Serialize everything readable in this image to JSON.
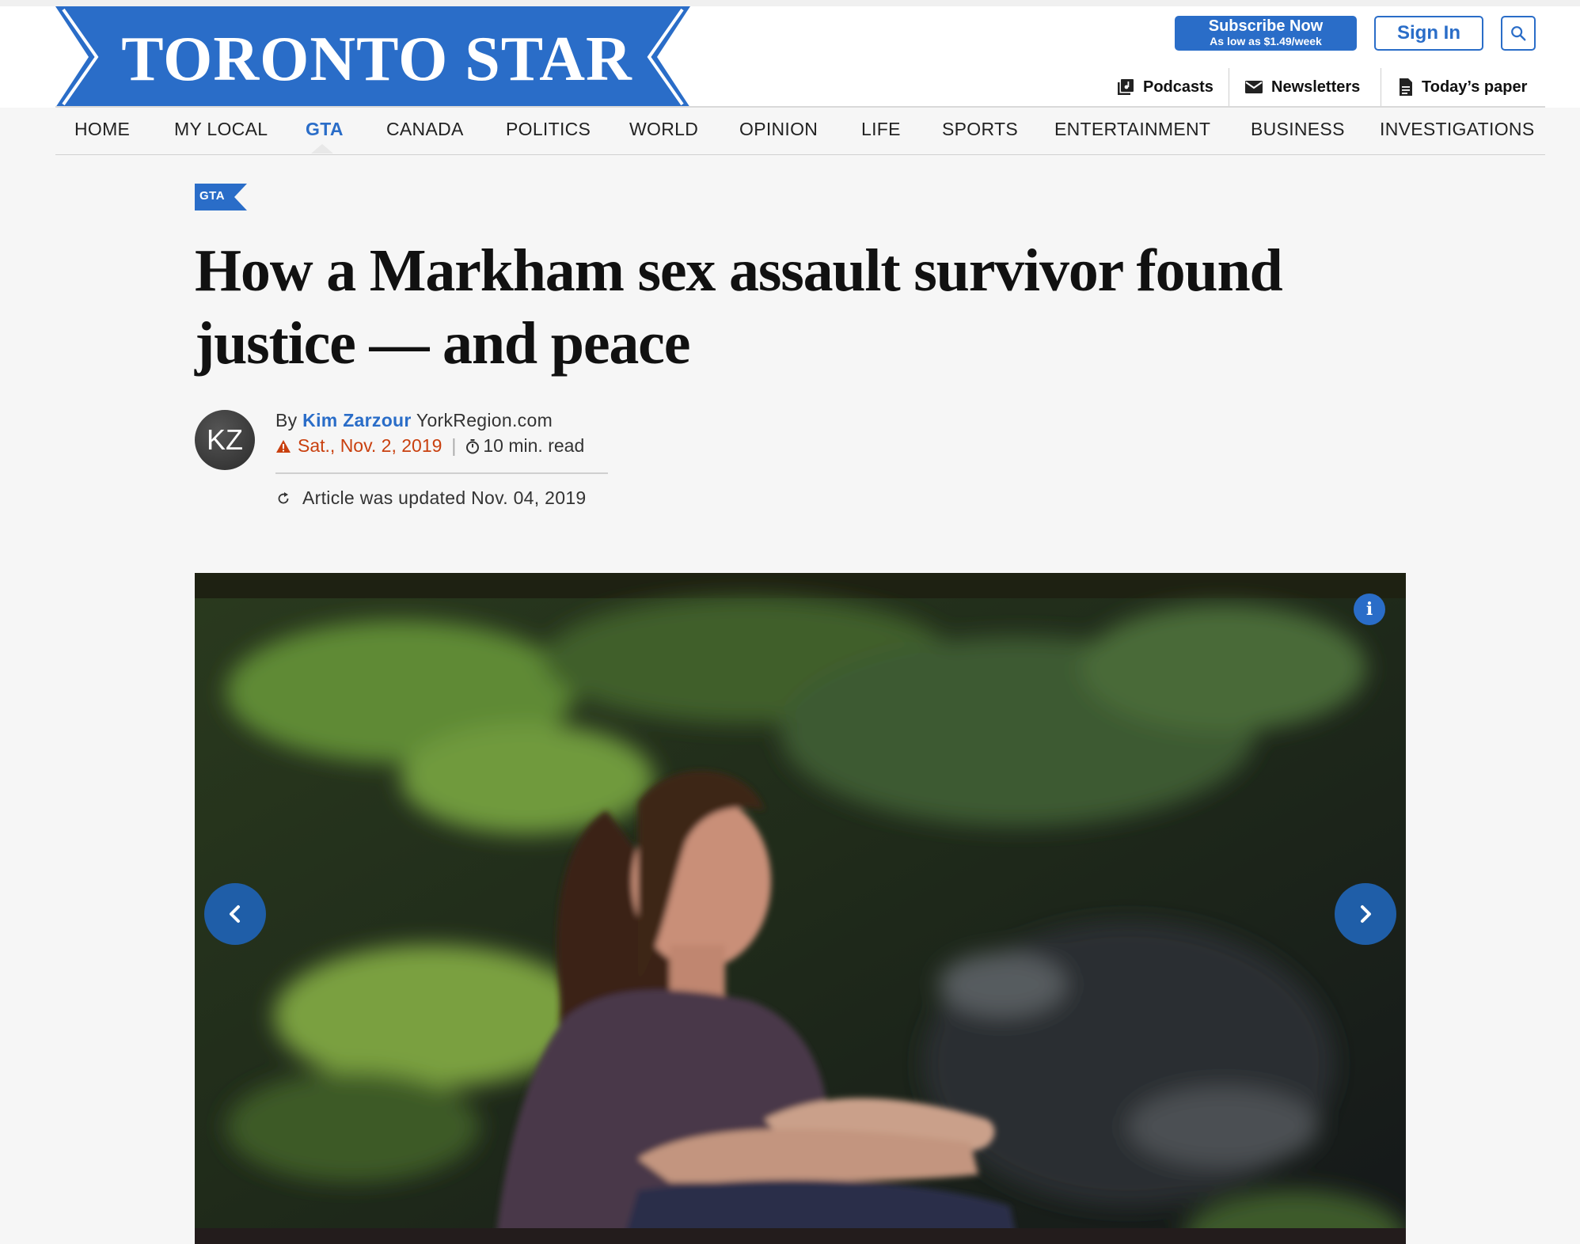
{
  "brand": {
    "name": "TORONTO STAR",
    "color": "#2a6dc8"
  },
  "subscribe": {
    "title": "Subscribe Now",
    "subtitle": "As low as $1.49/week"
  },
  "signin": {
    "label": "Sign In"
  },
  "search": {
    "icon": "search-icon"
  },
  "utility_links": [
    {
      "label": "Podcasts",
      "icon": "podcast-icon"
    },
    {
      "label": "Newsletters",
      "icon": "mail-icon"
    },
    {
      "label": "Today’s paper",
      "icon": "document-icon"
    }
  ],
  "nav": {
    "items": [
      "HOME",
      "MY LOCAL",
      "GTA",
      "CANADA",
      "POLITICS",
      "WORLD",
      "OPINION",
      "LIFE",
      "SPORTS",
      "ENTERTAINMENT",
      "BUSINESS",
      "INVESTIGATIONS"
    ],
    "active": "GTA"
  },
  "article": {
    "section": "GTA",
    "headline": "How a Markham sex assault survivor found justice — and peace",
    "author_initials": "KZ",
    "by": "By",
    "author": "Kim Zarzour",
    "source": "YorkRegion.com",
    "date": "Sat., Nov. 2, 2019",
    "read_time": "10 min. read",
    "updated": "Article was updated Nov. 04, 2019"
  },
  "media": {
    "info_icon": "info-icon",
    "prev_icon": "chevron-left-icon",
    "next_icon": "chevron-right-icon",
    "info_glyph": "i"
  }
}
